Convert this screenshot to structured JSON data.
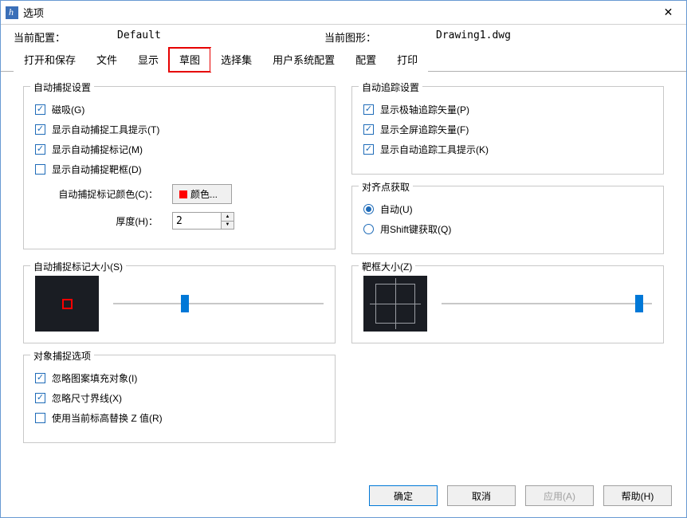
{
  "window": {
    "title": "选项"
  },
  "info": {
    "config_label": "当前配置：",
    "config_value": "Default",
    "drawing_label": "当前图形：",
    "drawing_value": "Drawing1.dwg"
  },
  "tabs": {
    "open_save": "打开和保存",
    "file": "文件",
    "display": "显示",
    "sketch": "草图",
    "select_set": "选择集",
    "user_sys": "用户系统配置",
    "config": "配置",
    "print": "打印"
  },
  "groups": {
    "autosnap": {
      "title": "自动捕捉设置",
      "magnet": "磁吸(G)",
      "tooltip": "显示自动捕捉工具提示(T)",
      "marker": "显示自动捕捉标记(M)",
      "aperture_box": "显示自动捕捉靶框(D)",
      "mark_color_label": "自动捕捉标记颜色(C)：",
      "color_button": "颜色...",
      "thickness_label": "厚度(H)：",
      "thickness_value": "2"
    },
    "autotrack": {
      "title": "自动追踪设置",
      "polar_vec": "显示极轴追踪矢量(P)",
      "fullscreen_vec": "显示全屏追踪矢量(F)",
      "tooltip": "显示自动追踪工具提示(K)"
    },
    "align_acq": {
      "title": "对齐点获取",
      "auto": "自动(U)",
      "shift": "用Shift键获取(Q)"
    },
    "marker_size": {
      "title": "自动捕捉标记大小(S)"
    },
    "aperture_size": {
      "title": "靶框大小(Z)"
    },
    "obj_snap": {
      "title": "对象捕捉选项",
      "ignore_hatch": "忽略图案填充对象(I)",
      "ignore_dim": "忽略尺寸界线(X)",
      "use_elev": "使用当前标高替换 Z 值(R)"
    }
  },
  "buttons": {
    "ok": "确定",
    "cancel": "取消",
    "apply": "应用(A)",
    "help": "帮助(H)"
  },
  "sliders": {
    "marker_size_pct": 34,
    "aperture_size_pct": 94
  }
}
